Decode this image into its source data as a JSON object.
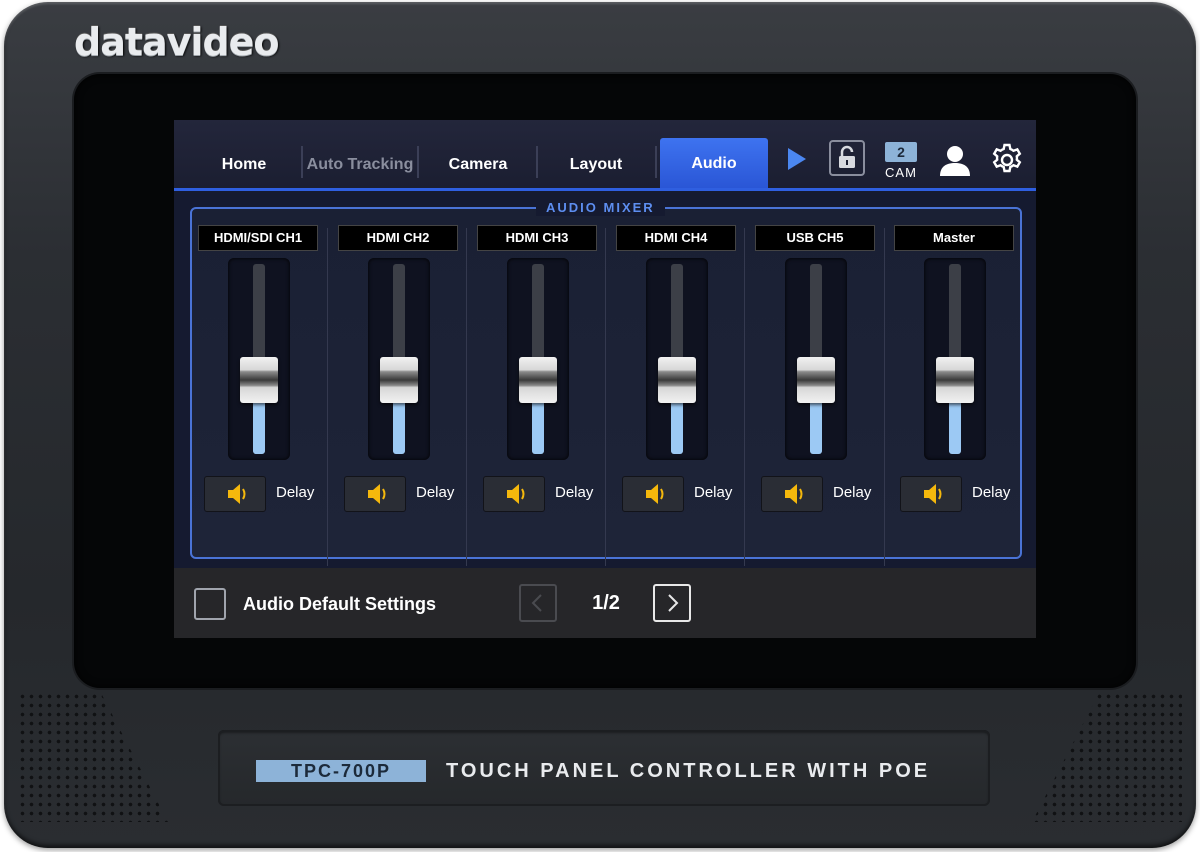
{
  "device": {
    "brand": "datavideo",
    "model": "TPC-700P",
    "product_title": "TOUCH PANEL CONTROLLER WITH POE"
  },
  "nav": {
    "tabs": [
      {
        "label": "Home",
        "state": "normal"
      },
      {
        "label": "Auto Tracking",
        "state": "disabled"
      },
      {
        "label": "Camera",
        "state": "normal"
      },
      {
        "label": "Layout",
        "state": "normal"
      },
      {
        "label": "Audio",
        "state": "active"
      }
    ],
    "icons": [
      "play-icon",
      "unlock-icon",
      "user-icon",
      "gear-icon"
    ],
    "cam_number": "2",
    "cam_label": "CAM"
  },
  "mixer": {
    "title": "AUDIO MIXER",
    "delay_label": "Delay",
    "channels": [
      {
        "name": "HDMI/SDI CH1",
        "level": 0.39
      },
      {
        "name": "HDMI CH2",
        "level": 0.39
      },
      {
        "name": "HDMI CH3",
        "level": 0.39
      },
      {
        "name": "HDMI CH4",
        "level": 0.39
      },
      {
        "name": "USB CH5",
        "level": 0.39
      },
      {
        "name": "Master",
        "level": 0.39
      }
    ]
  },
  "footer": {
    "default_settings_label": "Audio Default Settings",
    "checkbox_checked": false,
    "page": "1/2"
  },
  "colors": {
    "accent": "#2f5fe0",
    "fader_fill": "#9cc9f4",
    "speaker": "#f5b80c",
    "badge": "#8db3d8"
  }
}
